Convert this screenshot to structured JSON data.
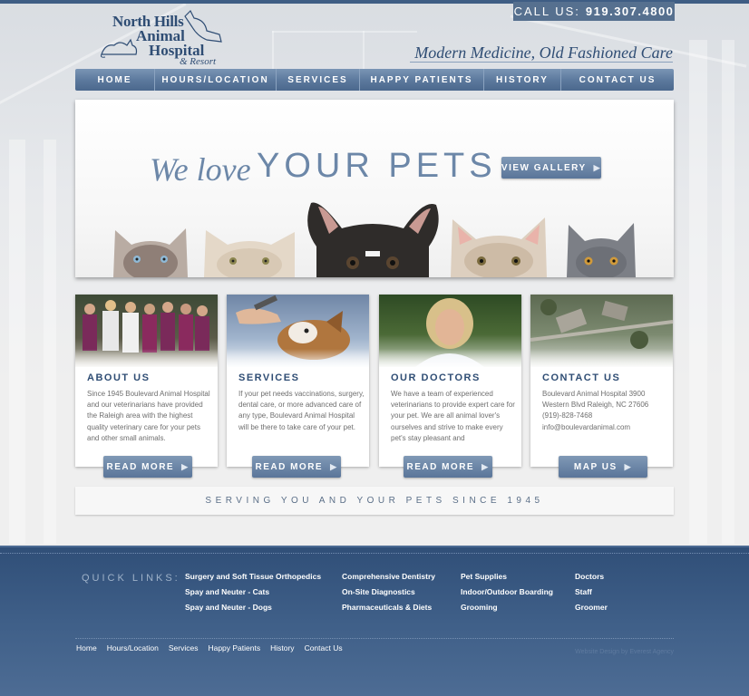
{
  "header": {
    "logo": {
      "line1": "North Hills",
      "line2": "Animal",
      "line3": "Hospital",
      "line4": "& Resort"
    },
    "phone_label": "CALL US:",
    "phone_number": "919.307.4800",
    "tagline": "Modern Medicine, Old Fashioned Care"
  },
  "nav": {
    "items": [
      {
        "label": "HOME"
      },
      {
        "label": "HOURS/LOCATION"
      },
      {
        "label": "SERVICES"
      },
      {
        "label": "HAPPY PATIENTS"
      },
      {
        "label": "HISTORY"
      },
      {
        "label": "CONTACT US"
      }
    ]
  },
  "hero": {
    "script": "We love",
    "headline": "YOUR PETS",
    "button": "VIEW GALLERY"
  },
  "cards": [
    {
      "title": "ABOUT US",
      "text": "Since 1945 Boulevard Animal Hospital and our veterinarians have provided the Raleigh area with the highest quality veterinary care for your pets and other small animals.",
      "button": "READ MORE"
    },
    {
      "title": "SERVICES",
      "text": "If your pet needs vaccinations, surgery, dental care, or more advanced care of any type, Boulevard Animal Hospital will be there to take care of your pet.",
      "button": "READ MORE"
    },
    {
      "title": "OUR DOCTORS",
      "text": "We have a team of experienced veterinarians to provide expert care for your pet.  We are all animal lover's ourselves and strive to make every pet's stay pleasant and",
      "button": "READ MORE"
    },
    {
      "title": "CONTACT US",
      "text": "Boulevard Animal Hospital 3900 Western Blvd  Raleigh, NC 27606 (919)-828-7468 info@boulevardanimal.com",
      "button": "MAP US"
    }
  ],
  "serving": "SERVING YOU AND YOUR PETS SINCE 1945",
  "footer": {
    "quick_links_label": "QUICK LINKS:",
    "columns": [
      [
        "Surgery and Soft Tissue Orthopedics",
        "Spay and Neuter - Cats",
        "Spay and Neuter - Dogs"
      ],
      [
        "Comprehensive Dentistry",
        "On-Site Diagnostics",
        "Pharmaceuticals & Diets"
      ],
      [
        "Pet Supplies",
        "Indoor/Outdoor Boarding",
        "Grooming"
      ],
      [
        "Doctors",
        "Staff",
        "Groomer"
      ]
    ],
    "nav": [
      "Home",
      "Hours/Location",
      "Services",
      "Happy Patients",
      "History",
      "Contact Us"
    ],
    "credit": "Website Design by Everest Agency"
  },
  "colors": {
    "brand_blue": "#2f4d74",
    "nav_blue": "#5d7a9e",
    "footer_blue": "#3f5f88"
  }
}
